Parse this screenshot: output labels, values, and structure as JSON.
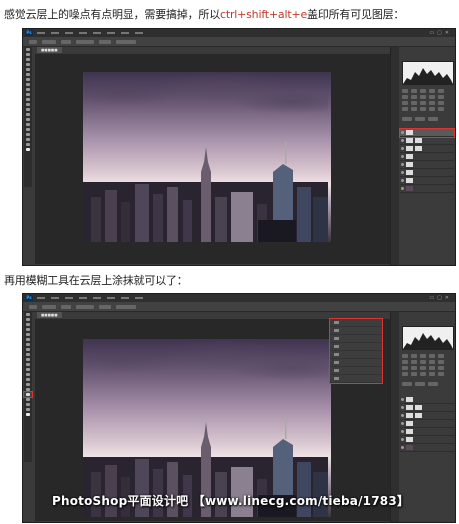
{
  "step1": {
    "caption_before": "感觉云层上的噪点有点明显，需要搞掉，所以",
    "caption_highlight": "ctrl+shift+alt+e",
    "caption_after": "盖印所有可见图层："
  },
  "step2": {
    "caption": "再用模糊工具在云层上涂抹就可以了："
  },
  "watermark": "PhotoShop平面设计吧 【www.linecg.com/tieba/1783】",
  "colors": {
    "highlight": "#c0392b",
    "marker": "#dd3333",
    "ps_dark": "#3a3a3a"
  },
  "icons": [
    "ps-logo-icon",
    "blur-tool-icon",
    "eye-icon",
    "layer-thumbnail-icon"
  ]
}
